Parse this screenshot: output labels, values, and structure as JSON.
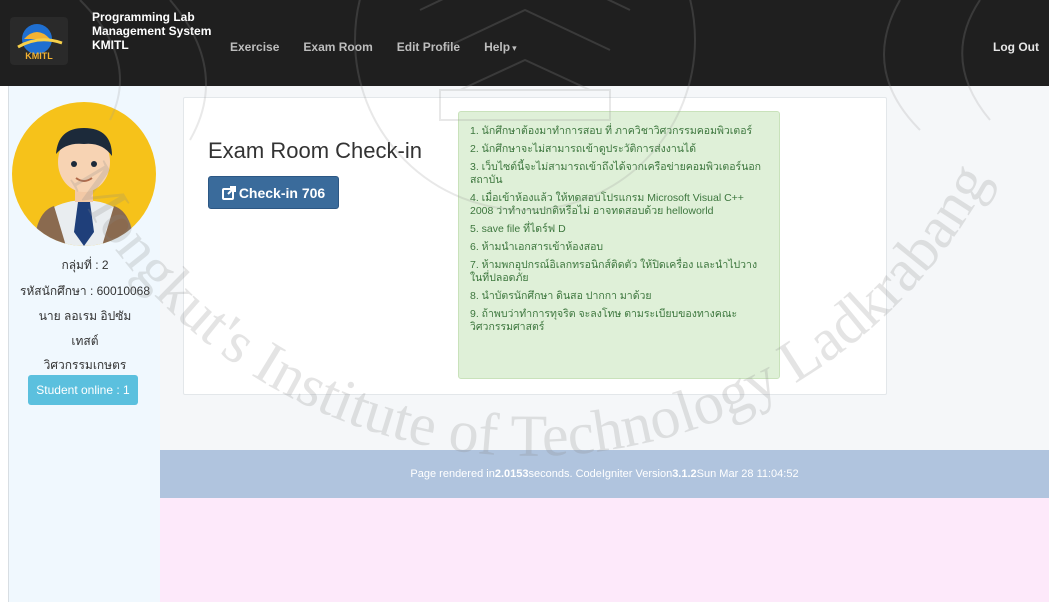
{
  "navbar": {
    "brand_line1": "Programming Lab",
    "brand_line2": "Management System",
    "brand_line3": "KMITL",
    "logo_text": "KMITL",
    "links": [
      "Exercise",
      "Exam Room",
      "Edit Profile",
      "Help"
    ],
    "logout": "Log Out"
  },
  "sidebar": {
    "group": "กลุ่มที่ : 2",
    "student_id": "รหัสนักศึกษา : 60010068",
    "name": "นาย ลอเรม อิปซัม",
    "surname": "เทสต์",
    "faculty": "วิศวกรรมเกษตร",
    "online_label": "Student online : 1"
  },
  "main": {
    "title": "Exam Room Check-in",
    "checkin_label": "Check-in 706",
    "rules": [
      "1. นักศึกษาต้องมาทำการสอบ ที่ ภาควิชาวิศวกรรมคอมพิวเตอร์",
      "2. นักศึกษาจะไม่สามารถเข้าดูประวัติการส่งงานได้",
      "3. เว็บไซต์นี้จะไม่สามารถเข้าถึงได้จากเครือข่ายคอมพิวเตอร์นอกสถาบัน",
      "4. เมื่อเข้าห้องแล้ว ให้ทดสอบโปรแกรม Microsoft Visual C++ 2008 ว่าทำงานปกติหรือไม่ อาจทดสอบด้วย helloworld",
      "5. save file ที่ไดร์ฟ D",
      "6. ห้ามนำเอกสารเข้าห้องสอบ",
      "7. ห้ามพกอุปกรณ์อิเลกทรอนิกส์ติดตัว ให้ปิดเครื่อง และนำไปวางในที่ปลอดภัย",
      "8. นำบัตรนักศึกษา ดินสอ ปากกา มาด้วย",
      "9. ถ้าพบว่าทำการทุจริต จะลงโทษ ตามระเบียบของทางคณะวิศวกรรมศาสตร์"
    ]
  },
  "footer": {
    "prefix": "Page rendered in ",
    "seconds": "2.0153",
    "middle": " seconds. CodeIgniter Version ",
    "version": "3.1.2",
    "suffix": " Sun Mar 28 11:04:52"
  },
  "watermark": {
    "text": "Mongkut's Institute of Technology Ladkrabang"
  },
  "colors": {
    "navbar": "#1f1f1f",
    "checkin_button": "#3a6b9b",
    "online_button": "#5bc0de",
    "rules_background": "#dff0d8",
    "footer_bar": "#b0c4de",
    "pink_area": "#fde9fa"
  }
}
